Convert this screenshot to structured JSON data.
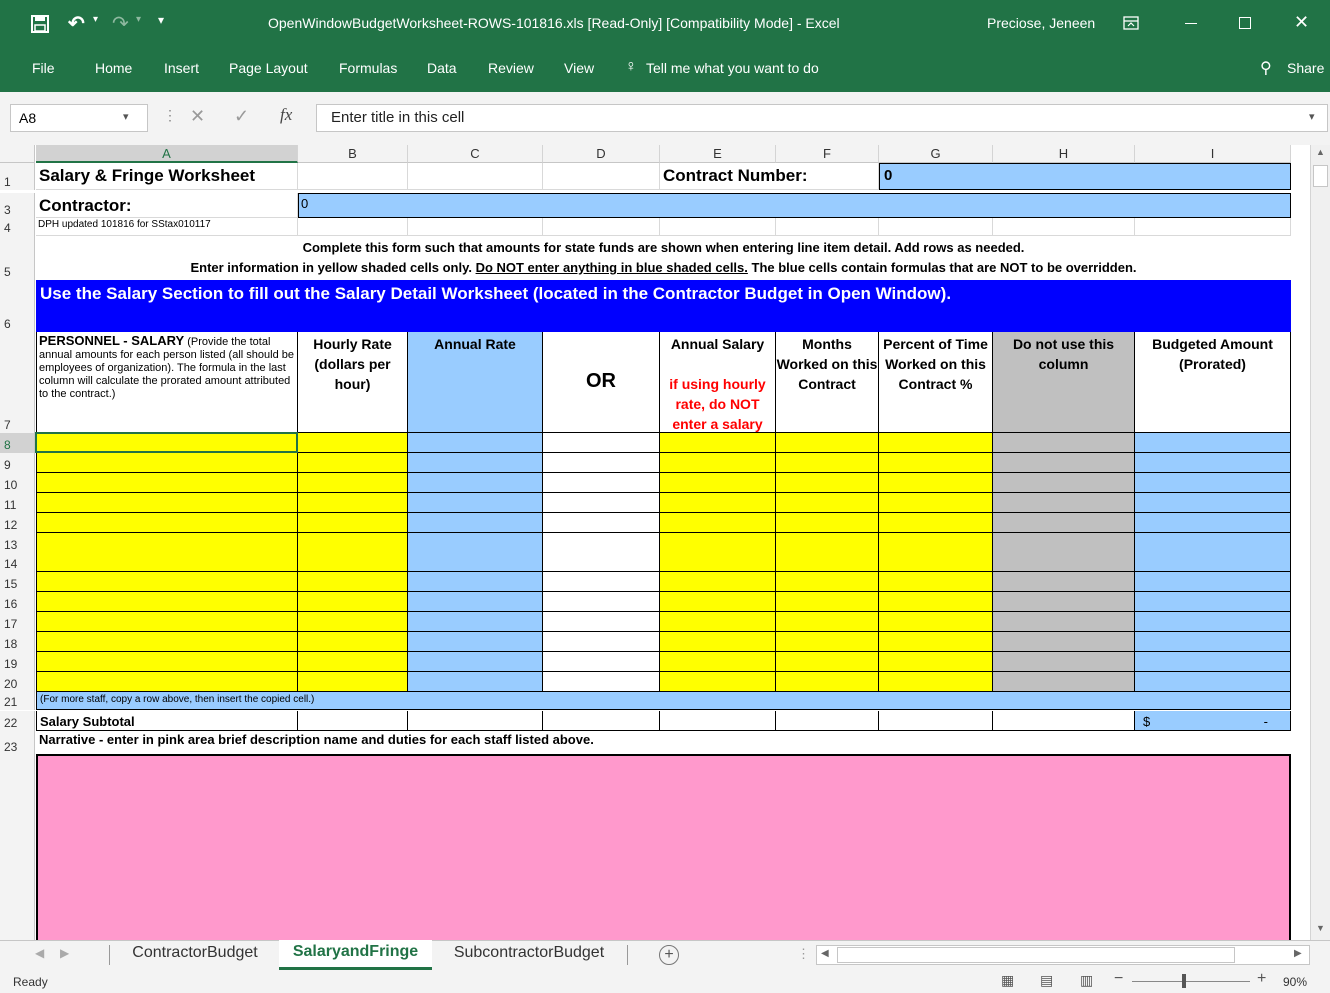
{
  "window": {
    "title": "OpenWindowBudgetWorksheet-ROWS-101816.xls  [Read-Only]  [Compatibility Mode]  -  Excel",
    "user": "Preciose, Jeneen"
  },
  "ribbon_tabs": [
    "File",
    "Home",
    "Insert",
    "Page Layout",
    "Formulas",
    "Data",
    "Review",
    "View"
  ],
  "tell_me": "Tell me what you want to do",
  "share": "Share",
  "formula_bar": {
    "namebox": "A8",
    "fx": "fx",
    "value": "Enter title in this cell"
  },
  "columns": [
    "A",
    "B",
    "C",
    "D",
    "E",
    "F",
    "G",
    "H",
    "I"
  ],
  "rows": [
    "1",
    "3",
    "4",
    "5",
    "6",
    "7",
    "8",
    "9",
    "10",
    "11",
    "12",
    "13",
    "14",
    "15",
    "16",
    "17",
    "18",
    "19",
    "20",
    "21",
    "22",
    "23"
  ],
  "sheet": {
    "r1": {
      "a": "Salary & Fringe Worksheet",
      "e": "Contract Number:",
      "g": "0"
    },
    "r3": {
      "a": "Contractor:",
      "b": "0"
    },
    "r4": {
      "a": "DPH updated 101816 for SStax010117"
    },
    "r5": {
      "line1": "Complete this form such that amounts for state funds are shown when entering line item detail.  Add rows as needed.",
      "line2_pre": "Enter information in yellow shaded cells only.  ",
      "line2_u": "Do NOT enter anything in blue shaded cells.",
      "line2_post": "  The blue cells contain formulas that are NOT to be overridden."
    },
    "r6": {
      "banner": "Use the Salary Section to fill out the Salary Detail Worksheet (located in the Contractor Budget in Open Window)."
    },
    "r7": {
      "a_bold": "PERSONNEL - SALARY",
      "a_rest": " (Provide the total annual amounts for each person listed (all should be employees of organization).  The formula in the last column will calculate the prorated amount attributed to the contract.)",
      "b": "Hourly Rate (dollars per hour)",
      "c": "Annual Rate",
      "d": "OR",
      "e": "Annual Salary",
      "e_red": "if using hourly rate, do NOT enter a salary",
      "f": "Months Worked on this Contract",
      "g": "Percent of Time Worked on this Contract %",
      "h": "Do not use this column",
      "i": "Budgeted Amount (Prorated)"
    },
    "data_row": {
      "a": "Enter title in this cell",
      "dollar": "$",
      "dash": "-",
      "or": "or"
    },
    "r21": {
      "a": "(For more staff, copy a row above, then insert the copied cell.)"
    },
    "r22": {
      "a": "Salary Subtotal",
      "i_dollar": "$",
      "i_dash": "-"
    },
    "r23": {
      "a": "Narrative - enter in pink area brief description name and duties for each staff listed above."
    }
  },
  "sheet_tabs": [
    "ContractorBudget",
    "SalaryandFringe",
    "SubcontractorBudget"
  ],
  "status": {
    "ready": "Ready",
    "zoom": "90%"
  }
}
